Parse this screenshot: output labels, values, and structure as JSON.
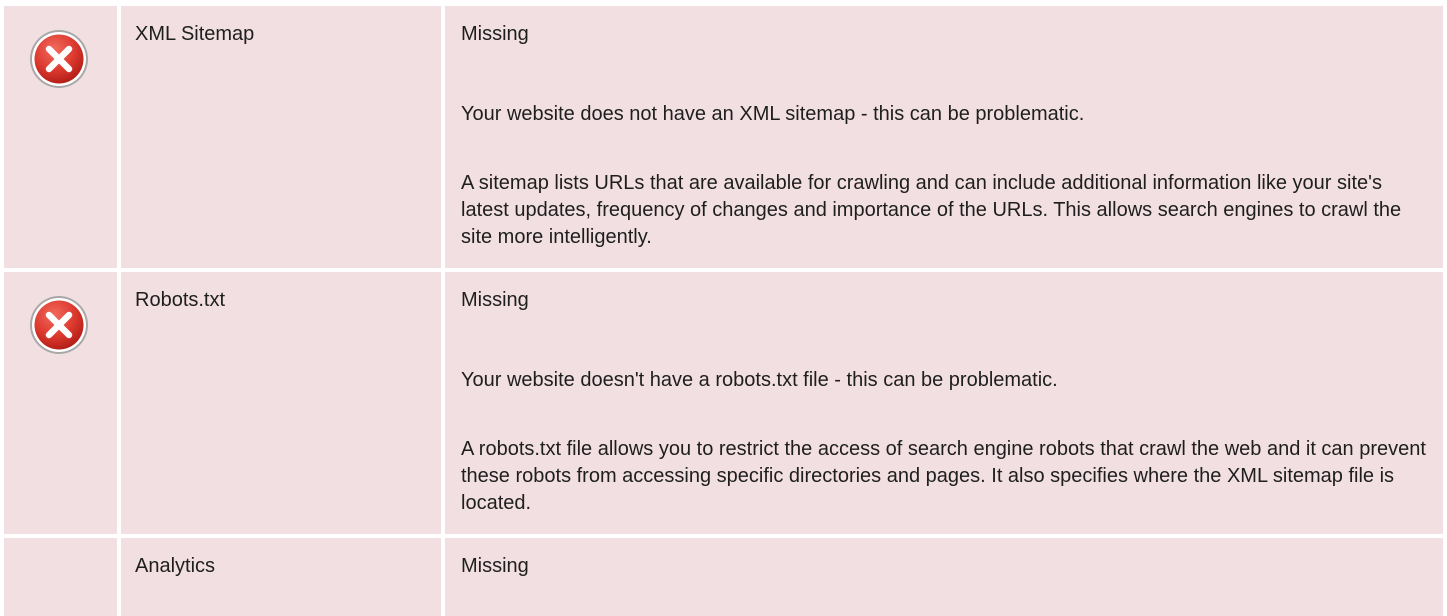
{
  "colors": {
    "row_background": "#f2dfe1",
    "text": "#1e1e1e",
    "error_icon": "#d9332b"
  },
  "checks": [
    {
      "icon": "error-x-icon",
      "name": "XML Sitemap",
      "status": "Missing",
      "summary": "Your website does not have an XML sitemap - this can be problematic.",
      "detail": "A sitemap lists URLs that are available for crawling and can include additional information like your site's latest updates, frequency of changes and importance of the URLs. This allows search engines to crawl the site more intelligently."
    },
    {
      "icon": "error-x-icon",
      "name": "Robots.txt",
      "status": "Missing",
      "summary": "Your website doesn't have a robots.txt file - this can be problematic.",
      "detail": "A robots.txt file allows you to restrict the access of search engine robots that crawl the web and it can prevent these robots from accessing specific directories and pages. It also specifies where the XML sitemap file is located."
    },
    {
      "name": "Analytics",
      "status": "Missing"
    }
  ]
}
